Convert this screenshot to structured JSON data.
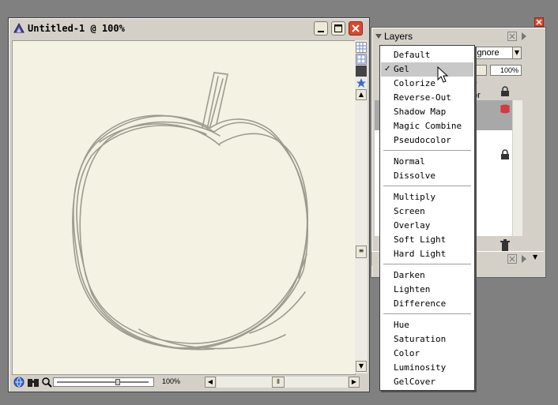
{
  "document": {
    "title": "Untitled-1 @ 100%",
    "zoom": "100%"
  },
  "layers_panel": {
    "title": "Layers",
    "mode_value": "ignore",
    "opacity": "100%",
    "label_partial_1": "y",
    "label_partial_2": "or"
  },
  "blend_menu": {
    "selected": "Gel",
    "groups": [
      [
        "Default",
        "Gel",
        "Colorize",
        "Reverse-Out",
        "Shadow Map",
        "Magic Combine",
        "Pseudocolor"
      ],
      [
        "Normal",
        "Dissolve"
      ],
      [
        "Multiply",
        "Screen",
        "Overlay",
        "Soft Light",
        "Hard Light"
      ],
      [
        "Darken",
        "Lighten",
        "Difference"
      ],
      [
        "Hue",
        "Saturation",
        "Color",
        "Luminosity",
        "GelCover"
      ]
    ]
  },
  "colors": {
    "canvas": "#f3f2e3",
    "sketch": "#8e8c80",
    "chrome": "#d4d0c8",
    "desktop": "#808080",
    "highlight": "#c8c8c8"
  },
  "icons": [
    "app-icon",
    "minimize-icon",
    "maximize-icon",
    "close-icon",
    "layers-icon",
    "star-icon",
    "globe-icon",
    "binoculars-icon",
    "magnifier-icon",
    "lock-icon",
    "layer-stack-icon",
    "trash-icon",
    "cursor-icon"
  ]
}
